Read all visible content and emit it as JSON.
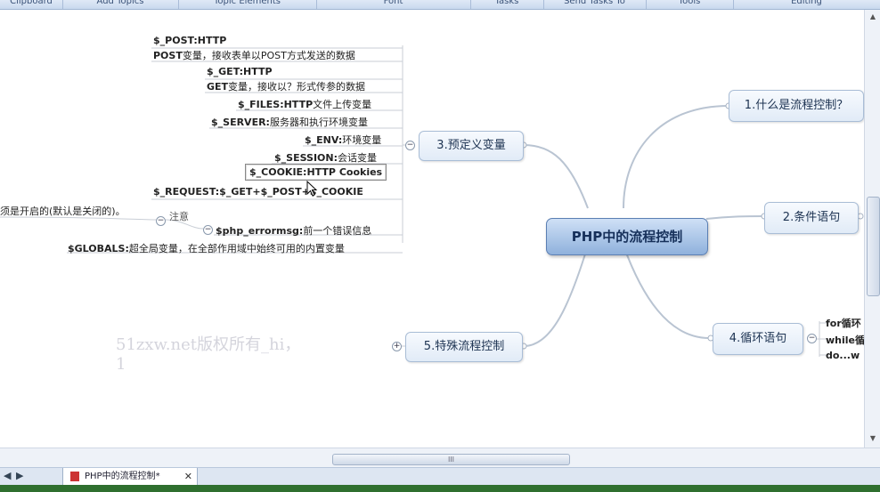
{
  "ribbon": {
    "groups": [
      "Clipboard",
      "Add Topics",
      "Topic Elements",
      "Font",
      "Tasks",
      "Send Tasks To",
      "Tools",
      "Editing"
    ]
  },
  "mindmap": {
    "central": "PHP中的流程控制",
    "right_topics": [
      "1.什么是流程控制？",
      "2.条件语句",
      "4.循环语句"
    ],
    "loop_items": [
      "for循环",
      "while循",
      "do...w"
    ],
    "left_topic": "3.预定义变量",
    "special_topic": "5.特殊流程控制",
    "vars": [
      {
        "name": "$_POST:HTTP",
        "desc": ""
      },
      {
        "name": "POST",
        "desc": "变量，接收表单以POST方式发送的数据"
      },
      {
        "name": "$_GET:HTTP",
        "desc": ""
      },
      {
        "name": "GET",
        "desc": "变量，接收以？形式传参的数据"
      },
      {
        "name": "$_FILES:HTTP",
        "desc": "文件上传变量"
      },
      {
        "name": "$_SERVER:",
        "desc": "服务器和执行环境变量"
      },
      {
        "name": "$_ENV:",
        "desc": "环境变量"
      },
      {
        "name": "$_SESSION:",
        "desc": "会话变量"
      },
      {
        "name": "$_COOKIE:HTTP Cookies",
        "desc": ""
      },
      {
        "name": "$_REQUEST:$_GET+$_POST+$_COOKIE",
        "desc": ""
      },
      {
        "name": "$php_errormsg:",
        "desc": "前一个错误信息"
      },
      {
        "name": "$GLOBALS:",
        "desc": "超全局变量，在全部作用域中始终可用的内置变量"
      }
    ],
    "note_label": "注意",
    "note_text": "须是开启的(默认是关闭的)。",
    "watermark": [
      "51zxw.net版权所有_hi，",
      "1"
    ]
  },
  "tabs": {
    "active": "PHP中的流程控制*"
  },
  "hscroll": {
    "grip": "III"
  },
  "colors": {
    "accent": "#5b7fb3",
    "node_border": "#a9bdd6",
    "branch": "#b9c4d2"
  }
}
